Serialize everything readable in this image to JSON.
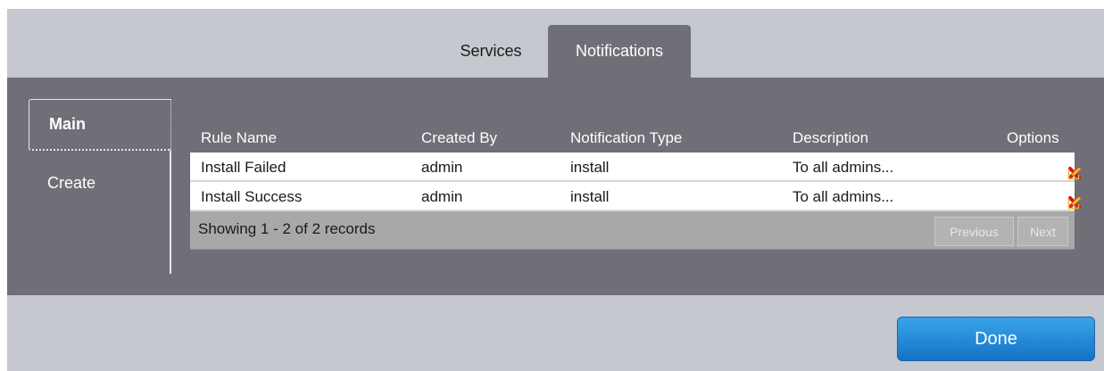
{
  "tabs": {
    "services": "Services",
    "notifications": "Notifications"
  },
  "sidebar": {
    "main": "Main",
    "create": "Create"
  },
  "table": {
    "headers": {
      "rule_name": "Rule Name",
      "created_by": "Created By",
      "notification_type": "Notification Type",
      "description": "Description",
      "options": "Options"
    },
    "rows": [
      {
        "rule_name": "Install Failed",
        "created_by": "admin",
        "notification_type": "install",
        "description": "To all admins..."
      },
      {
        "rule_name": "Install Success",
        "created_by": "admin",
        "notification_type": "install",
        "description": "To all admins..."
      }
    ],
    "status": "Showing 1 - 2 of 2 records",
    "previous": "Previous",
    "next": "Next"
  },
  "done_label": "Done",
  "icons": {
    "delete": "delete-x-icon",
    "edit": "edit-pencil-icon"
  },
  "colors": {
    "panel": "#706e77",
    "accent": "#1f84d6",
    "delete": "#e01010",
    "edit": "#e8b430"
  }
}
